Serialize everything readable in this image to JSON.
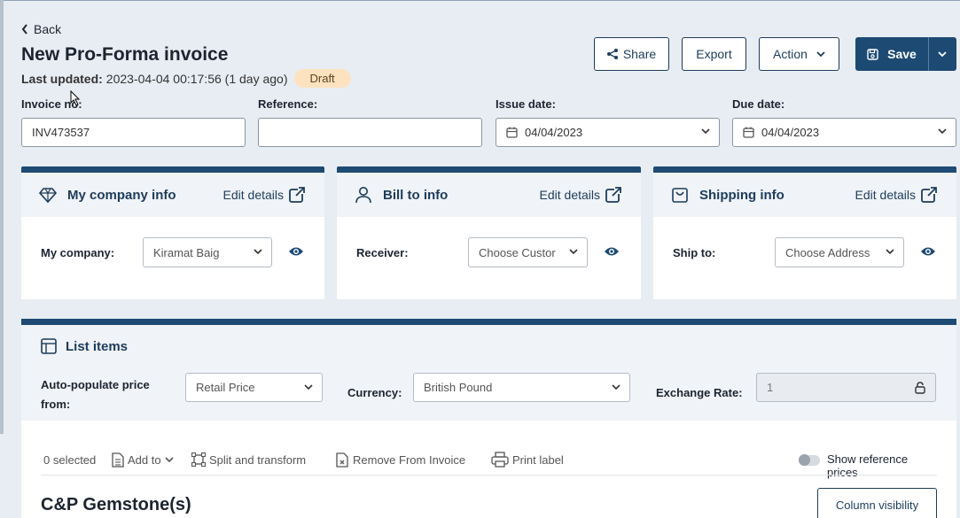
{
  "header": {
    "back_label": "Back",
    "title": "New Pro-Forma invoice",
    "last_updated_label": "Last updated:",
    "last_updated_value": "2023-04-04 00:17:56 (1 day ago)",
    "status": "Draft"
  },
  "toolbar": {
    "share_label": "Share",
    "export_label": "Export",
    "action_label": "Action",
    "save_label": "Save"
  },
  "fields": {
    "invoice_no_label": "Invoice no:",
    "invoice_no_value": "INV473537",
    "reference_label": "Reference:",
    "reference_value": "",
    "issue_date_label": "Issue date:",
    "issue_date_value": "04/04/2023",
    "due_date_label": "Due date:",
    "due_date_value": "04/04/2023"
  },
  "cards": {
    "company": {
      "title": "My company info",
      "edit_label": "Edit details",
      "field_label": "My company:",
      "selected": "Kiramat Baig"
    },
    "bill": {
      "title": "Bill to info",
      "edit_label": "Edit details",
      "field_label": "Receiver:",
      "selected": "Choose Custor"
    },
    "shipping": {
      "title": "Shipping info",
      "edit_label": "Edit details",
      "field_label": "Ship to:",
      "selected": "Choose Address"
    }
  },
  "list": {
    "title": "List items",
    "auto_populate_label": "Auto-populate price from:",
    "auto_populate_value": "Retail Price",
    "currency_label": "Currency:",
    "currency_value": "British Pound",
    "exchange_rate_label": "Exchange Rate:",
    "exchange_rate_value": "1",
    "selected_count": "0 selected",
    "add_to_label": "Add to",
    "split_label": "Split and transform",
    "remove_label": "Remove From Invoice",
    "print_label": "Print label",
    "show_ref_prices_label": "Show reference prices",
    "section_title": "C&P Gemstone(s)",
    "column_visibility_label": "Column visibility"
  },
  "colors": {
    "primary": "#1d4a73",
    "badge_bg": "#fde2bf",
    "page_bg": "#e8edf3"
  }
}
